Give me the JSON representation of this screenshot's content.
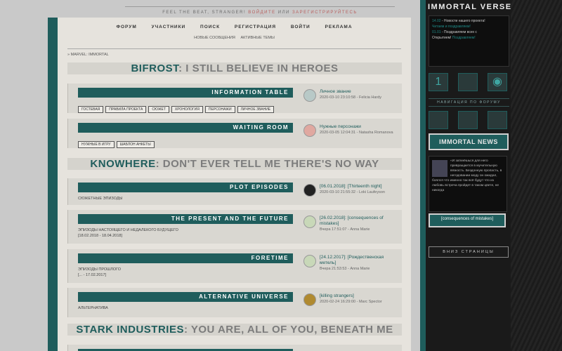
{
  "topbar": {
    "tagline": "FEEL THE BEAT, STRANGER!",
    "login": "ВОЙДИТЕ",
    "or": "ИЛИ",
    "register": "ЗАРЕГИСТРИРУЙТЕСЬ"
  },
  "nav": {
    "items": [
      "ФОРУМ",
      "УЧАСТНИКИ",
      "ПОИСК",
      "РЕГИСТРАЦИЯ",
      "ВОЙТИ",
      "РЕКЛАМА"
    ],
    "sub": [
      "НОВЫЕ СООБЩЕНИЯ",
      "АКТИВНЫЕ ТЕМЫ"
    ]
  },
  "breadcrumb": "» MARVEL: IMMORTAL",
  "categories": [
    {
      "accent": "BIFROST",
      "rest": ": I STILL BELIEVE IN HEROES"
    },
    {
      "accent": "KNOWHERE",
      "rest": ": DON'T EVER TELL ME THERE'S NO WAY"
    },
    {
      "accent": "STARK INDUSTRIES",
      "rest": ": YOU ARE, ALL OF YOU, BENEATH ME"
    }
  ],
  "forums": [
    {
      "title": "INFORMATION TABLE",
      "tags": [
        "ГОСТЕВАЯ",
        "ПРАВИЛА ПРОЕКТА",
        "СЮЖЕТ",
        "ХРОНОЛОГИЯ",
        "ПЕРСОНАЖИ",
        "ЛИЧНОЕ ЗВАНИЕ"
      ],
      "last_title": "Личное звание",
      "last_meta": "2020-03-10 23:10:58 - Felicia Hardy"
    },
    {
      "title": "WAITING ROOM",
      "tags": [
        "НУЖНЫЕ В ИГРУ",
        "ШАБЛОН АНКЕТЫ"
      ],
      "last_title": "Нужные персонажи",
      "last_meta": "2020-03-05 12:04:31 - Natasha Romanova"
    },
    {
      "title": "PLOT EPISODES",
      "desc": "СЮЖЕТНЫЕ ЭПИЗОДЫ",
      "desc2": "",
      "last_title": "[06.01.2018]: [Thirteenth night]",
      "last_meta": "2020-03-10 21:55:32 - Loki Laufeyson"
    },
    {
      "title": "THE PRESENT AND THE FUTURE",
      "desc": "ЭПИЗОДЫ НАСТОЯЩЕГО И НЕДАЛЕКОГО БУДУЩЕГО",
      "desc2": "[18.02.2018 - 18.04.2018]",
      "last_title": "[26.02.2018]: [consequences of mistakes]",
      "last_meta": "Вчера 17:51:07 - Anna Marie"
    },
    {
      "title": "FORETIME",
      "desc": "ЭПИЗОДЫ ПРОШЛОГО",
      "desc2": "[... - 17.02.2017]",
      "last_title": "[24.12.2017]: [Рождественская метель]",
      "last_meta": "Вчера 21:53:53 - Anna Marie"
    },
    {
      "title": "ALTERNATIVE UNIVERSE",
      "desc": "АЛЬТЕРНАТИВА",
      "desc2": "",
      "last_title": "[killing strangers]",
      "last_meta": "2020-02-24 16:29:00 - Marc Spector"
    }
  ],
  "sidebar": {
    "logo": "IMMORTAL VERSE",
    "news_date1": "14.02",
    "news_text1": "- Новости нашего проекта!",
    "news_sub1": "Читаем и поздравляем!",
    "news_date2": "01.01",
    "news_text2": "- Поздравляем всех с",
    "news_sub2a": "Открытием!",
    "news_sub2b": "Поздравляем!",
    "tile_number": "1",
    "nav_header": "НАВИГАЦИЯ ПО ФОРУМУ",
    "news_button": "IMMORTAL NEWS",
    "post_text": "«И заткнёшься для него превращается в мучительную вязкость. Бездонную пропасть, в негодовании моду он ожидал, боялся что именно так всё будут что из любовь встреча пройдет в таком цвете, не никогда",
    "post_title": "[consequences of mistakes]",
    "bottom_button": "ВНИЗ СТРАНИЦЫ"
  }
}
